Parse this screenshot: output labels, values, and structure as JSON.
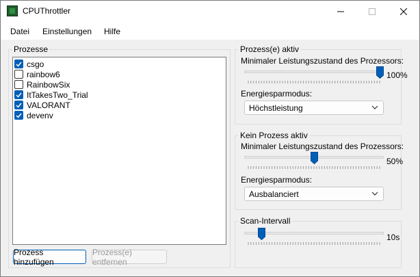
{
  "window": {
    "title": "CPUThrottler",
    "icon": "app-chip-icon",
    "controls": [
      "minimize-icon",
      "maximize-icon",
      "close-icon"
    ]
  },
  "menu": {
    "items": [
      "Datei",
      "Einstellungen",
      "Hilfe"
    ]
  },
  "processes": {
    "legend": "Prozesse",
    "items": [
      {
        "name": "csgo",
        "checked": true
      },
      {
        "name": "rainbow6",
        "checked": false
      },
      {
        "name": "RainbowSix",
        "checked": false
      },
      {
        "name": "ItTakesTwo_Trial",
        "checked": true
      },
      {
        "name": "VALORANT",
        "checked": true
      },
      {
        "name": "devenv",
        "checked": true
      }
    ],
    "add_button": "Prozess hinzufügen",
    "remove_button": "Prozess(e) entfernen"
  },
  "active": {
    "legend": "Prozess(e) aktiv",
    "min_state_label": "Minimaler Leistungszustand des Prozessors:",
    "min_state_value": "100%",
    "min_state_fraction": 1.0,
    "power_mode_label": "Energiesparmodus:",
    "power_mode_selected": "Höchstleistung"
  },
  "inactive": {
    "legend": "Kein Prozess aktiv",
    "min_state_label": "Minimaler Leistungszustand des Prozessors:",
    "min_state_value": "50%",
    "min_state_fraction": 0.5,
    "power_mode_label": "Energiesparmodus:",
    "power_mode_selected": "Ausbalanciert"
  },
  "scan": {
    "legend": "Scan-Intervall",
    "value": "10s",
    "fraction": 0.1
  },
  "colors": {
    "accent": "#005fb8",
    "window_bg": "#f0f0f0",
    "titlebar_bg": "#ffffff"
  }
}
